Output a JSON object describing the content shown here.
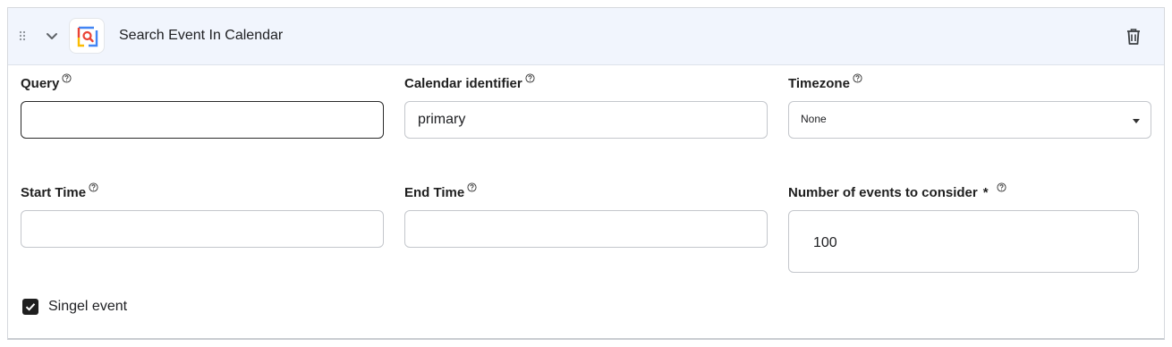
{
  "header": {
    "title": "Search Event In Calendar",
    "icons": {
      "drag": "drag-handle-icon",
      "expand": "chevron-down-icon",
      "app": "calendar-search-icon",
      "delete": "trash-icon"
    }
  },
  "fields": {
    "query": {
      "label": "Query",
      "value": ""
    },
    "calendar_identifier": {
      "label": "Calendar identifier",
      "value": "primary"
    },
    "timezone": {
      "label": "Timezone",
      "value": "None"
    },
    "start_time": {
      "label": "Start Time",
      "value": ""
    },
    "end_time": {
      "label": "End Time",
      "value": ""
    },
    "num_events": {
      "label": "Number of events to consider",
      "required_mark": "*",
      "value": "100"
    }
  },
  "single_event": {
    "label": "Singel event",
    "checked": true
  },
  "colors": {
    "header_bg": "#f1f5fd",
    "border": "#c4c7cc",
    "checkbox": "#1f1f1f"
  }
}
